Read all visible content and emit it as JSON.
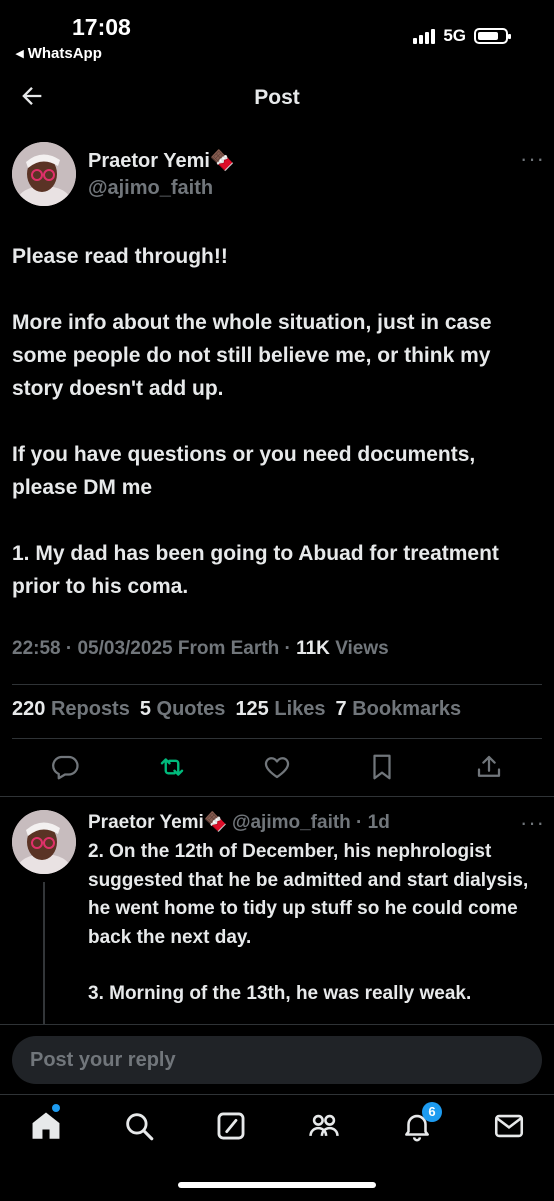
{
  "status_bar": {
    "time": "17:08",
    "back_app": "◂ WhatsApp",
    "network": "5G"
  },
  "nav": {
    "title": "Post"
  },
  "post": {
    "author_name": "Praetor Yemi🍫",
    "author_handle": "@ajimo_faith",
    "paragraphs": [
      "Please read through!!",
      "More info about the whole situation, just in case some people do not still believe me, or think my story doesn't add up.",
      "If you have questions or you need documents, please DM me",
      "1. My dad has been going to Abuad for treatment prior to his coma."
    ],
    "timestamp": "22:58 · 05/03/2025 From Earth ·",
    "views_count": "11K",
    "views_label": "Views",
    "stats": {
      "reposts_count": "220",
      "reposts_label": "Reposts",
      "quotes_count": "5",
      "quotes_label": "Quotes",
      "likes_count": "125",
      "likes_label": "Likes",
      "bookmarks_count": "7",
      "bookmarks_label": "Bookmarks"
    }
  },
  "reply": {
    "author_name": "Praetor Yemi🍫",
    "author_meta": "@ajimo_faith · 1d",
    "paragraphs": [
      "2. On the 12th of December, his nephrologist suggested that he be admitted and start dialysis, he went home to tidy up stuff so he could come back the next day.",
      "3. Morning of the 13th, he was really weak."
    ]
  },
  "composer": {
    "placeholder": "Post your reply"
  },
  "bottom_nav": {
    "notifications_badge": "6"
  },
  "colors": {
    "background": "#000000",
    "text": "#e7e9ea",
    "muted": "#71767b",
    "accent": "#1d9bf0",
    "repost_green": "#00ba7c"
  },
  "icons": [
    "back-arrow-icon",
    "more-icon",
    "reply-icon",
    "repost-icon",
    "like-icon",
    "bookmark-icon",
    "share-icon",
    "home-icon",
    "search-icon",
    "grok-icon",
    "communities-icon",
    "notifications-icon",
    "messages-icon"
  ]
}
